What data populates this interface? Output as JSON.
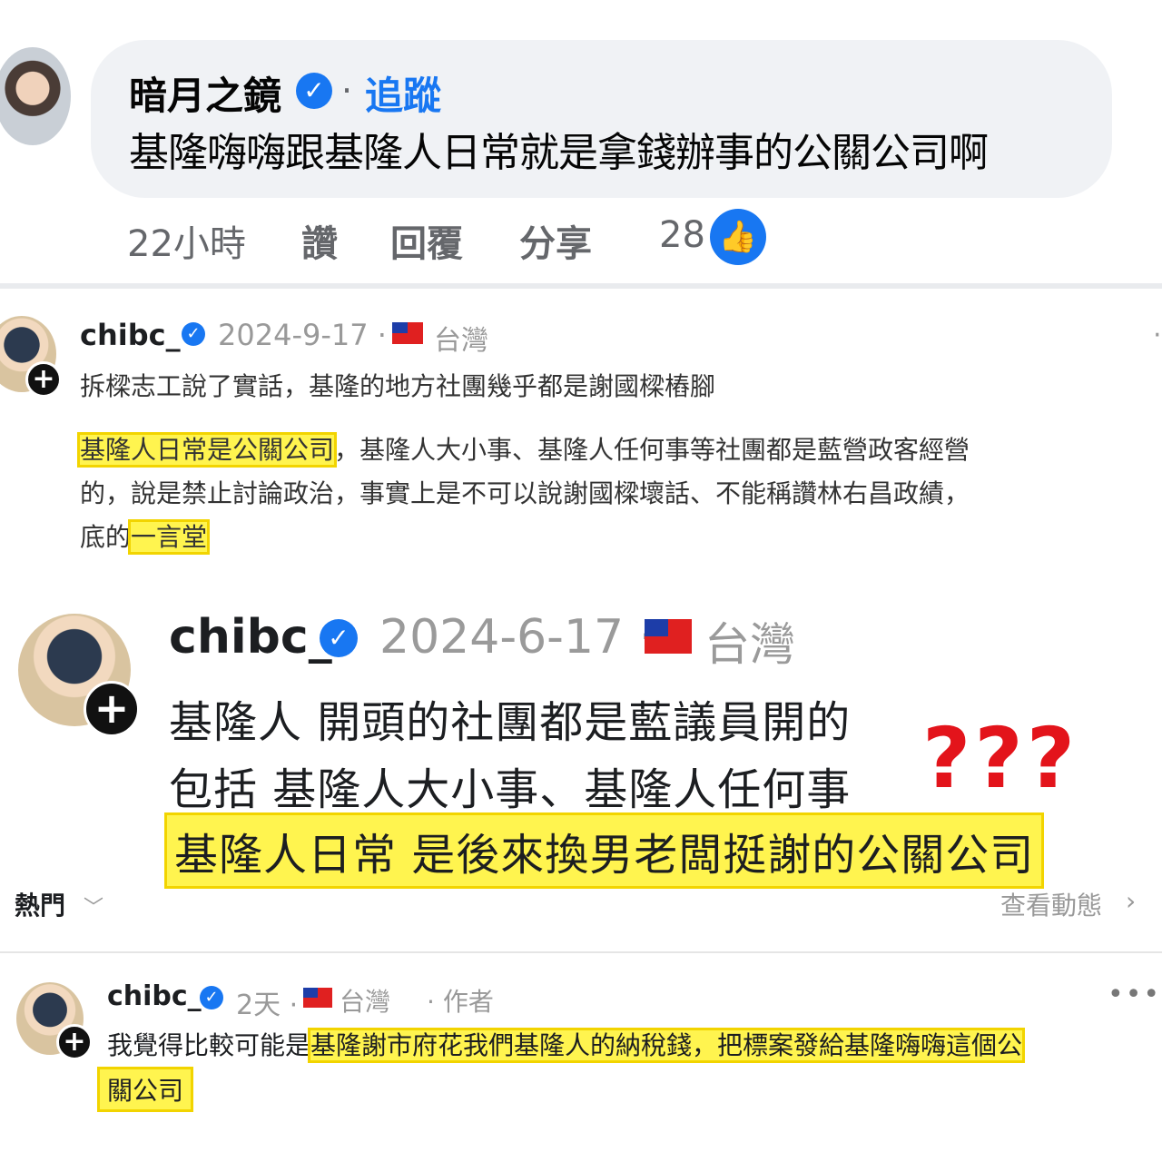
{
  "fb_comment": {
    "author": "暗月之鏡",
    "follow_label": "追蹤",
    "text": "基隆嗨嗨跟基隆人日常就是拿錢辦事的公關公司啊",
    "time": "22小時",
    "like_label": "讚",
    "reply_label": "回覆",
    "share_label": "分享",
    "reaction_count": "28"
  },
  "post_1": {
    "username": "chibc_",
    "date": "2024-9-17",
    "region": "台灣",
    "line1": "拆樑志工說了實話，基隆的地方社團幾乎都是謝國樑樁腳",
    "line2_highlight": "基隆人日常是公關公司",
    "line2_rest": "，基隆人大小事、基隆人任何事等社團都是藍營政客經營",
    "line3": "的，說是禁止討論政治，事實上是不可以說謝國樑壞話、不能稱讚林右昌政績，",
    "line4_plain": "底的",
    "line4_highlight": "一言堂"
  },
  "post_2": {
    "username": "chibc_",
    "date": "2024-6-17",
    "region": "台灣",
    "line1": "基隆人 開頭的社團都是藍議員開的",
    "line2": "包括 基隆人大小事、基隆人任何事",
    "line3_highlight": "基隆人日常 是後來換男老闆挺謝的公關公司",
    "annotation": "???",
    "sort_label": "熱門",
    "view_activity_label": "查看動態"
  },
  "reply": {
    "username": "chibc_",
    "time": "2天",
    "region": "台灣",
    "author_tag": "作者",
    "line1_plain": "我覺得比較可能是",
    "line1_highlight": "基隆謝市府花我們基隆人的納稅錢，把標案發給基隆嗨嗨這個公",
    "line2_highlight": "關公司"
  },
  "icons": {
    "verified": "verified-badge-icon",
    "like": "thumbs-up-icon",
    "flag": "taiwan-flag-icon",
    "follow_plus": "plus-icon",
    "more": "more-options-icon",
    "chevron": "chevron-icon"
  },
  "colors": {
    "facebook_blue": "#1877f2",
    "highlight": "#fff44f",
    "annotation_red": "#e3141b"
  }
}
